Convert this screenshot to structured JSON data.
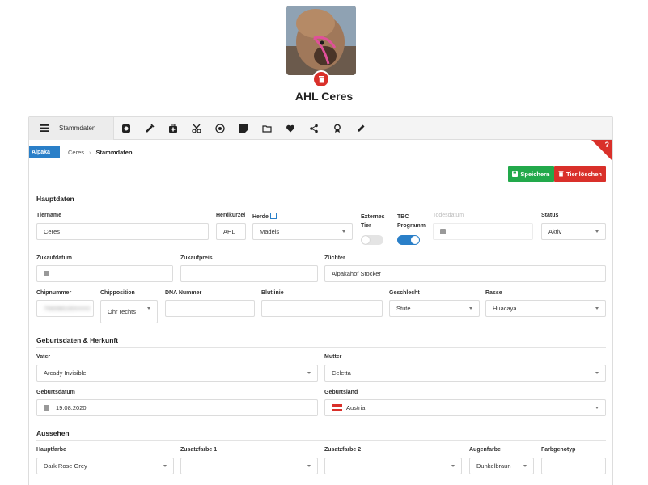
{
  "animal": {
    "name": "AHL Ceres"
  },
  "toolbar": {
    "main_label": "Stammdaten",
    "icons": [
      "scale-icon",
      "syringe-icon",
      "medical-kit-icon",
      "scissors-icon",
      "target-icon",
      "note-icon",
      "folder-icon",
      "heart-icon",
      "share-icon",
      "award-icon",
      "pencil-icon"
    ]
  },
  "help": "?",
  "breadcrumb": {
    "badge": "Alpaka",
    "animal": "Ceres",
    "separator": "›",
    "current": "Stammdaten"
  },
  "actions": {
    "save": "Speichern",
    "delete": "Tier löschen"
  },
  "colors": {
    "accent": "#2a7fc8",
    "save": "#22a94b",
    "danger": "#d9302a"
  },
  "sections": {
    "hauptdaten": "Hauptdaten",
    "geburt": "Geburtsdaten & Herkunft",
    "aussehen": "Aussehen"
  },
  "hauptdaten": {
    "tiername": {
      "label": "Tiername",
      "value": "Ceres"
    },
    "herdkuerzel": {
      "label": "Herdkürzel",
      "value": "AHL"
    },
    "herde": {
      "label": "Herde",
      "value": "Mädels"
    },
    "externes_tier": {
      "label": "Externes Tier",
      "on": false
    },
    "tbc": {
      "label": "TBC Programm",
      "on": true
    },
    "todesdatum": {
      "label": "Todesdatum",
      "value": ""
    },
    "status": {
      "label": "Status",
      "value": "Aktiv"
    },
    "zukaufdatum": {
      "label": "Zukaufdatum",
      "value": ""
    },
    "zukaufpreis": {
      "label": "Zukaufpreis",
      "value": ""
    },
    "zuechter": {
      "label": "Züchter",
      "value": "Alpakahof Stocker"
    },
    "chipnummer": {
      "label": "Chipnummer",
      "value": "756098100XXXX"
    },
    "chipposition": {
      "label": "Chipposition",
      "value": "Ohr rechts"
    },
    "dna": {
      "label": "DNA Nummer",
      "value": ""
    },
    "blutlinie": {
      "label": "Blutlinie",
      "value": ""
    },
    "geschlecht": {
      "label": "Geschlecht",
      "value": "Stute"
    },
    "rasse": {
      "label": "Rasse",
      "value": "Huacaya"
    }
  },
  "geburt": {
    "vater": {
      "label": "Vater",
      "value": "Arcady Invisible"
    },
    "mutter": {
      "label": "Mutter",
      "value": "Celetta"
    },
    "geburtsdatum": {
      "label": "Geburtsdatum",
      "value": "19.08.2020"
    },
    "geburtsland": {
      "label": "Geburtsland",
      "value": "Austria"
    }
  },
  "aussehen": {
    "hauptfarbe": {
      "label": "Hauptfarbe",
      "value": "Dark Rose Grey"
    },
    "zusatzfarbe1": {
      "label": "Zusatzfarbe 1",
      "value": ""
    },
    "zusatzfarbe2": {
      "label": "Zusatzfarbe 2",
      "value": ""
    },
    "augenfarbe": {
      "label": "Augenfarbe",
      "value": "Dunkelbraun"
    },
    "farbgenotyp": {
      "label": "Farbgenotyp",
      "value": ""
    }
  }
}
